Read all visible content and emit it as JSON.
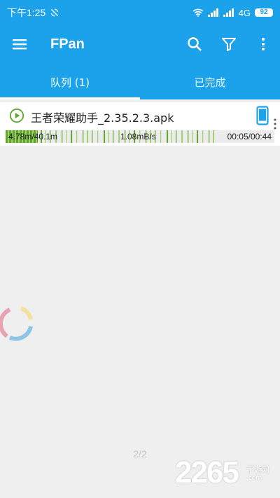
{
  "status_bar": {
    "time": "下午1:25",
    "network": "4G",
    "battery": "92"
  },
  "toolbar": {
    "title": "FPan",
    "icons": [
      "menu-icon",
      "search-icon",
      "filter-icon",
      "more-vert-icon"
    ]
  },
  "tabs": [
    {
      "label": "队列 (1)",
      "active": true
    },
    {
      "label": "已完成",
      "active": false
    }
  ],
  "downloads": [
    {
      "file_name": "王者荣耀助手_2.35.2.3.apk",
      "size_progress": "4.78m/40.1m",
      "speed": "1.08mB/s",
      "time": "00:05/00:44",
      "progress": 0.12
    }
  ],
  "page_indicator": "2/2",
  "watermark": {
    "number": "2265",
    "text": "手游网",
    "url": ".com"
  },
  "colors": {
    "primary": "#1ba2ea",
    "progress": "#5fa62c",
    "background": "#efefef"
  }
}
